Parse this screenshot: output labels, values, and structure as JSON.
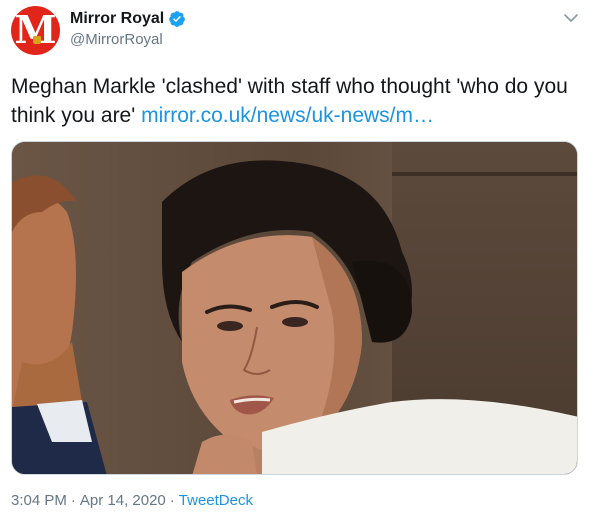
{
  "user": {
    "display_name": "Mirror Royal",
    "handle": "@MirrorRoyal",
    "avatar_letter": "M",
    "verified": true
  },
  "tweet": {
    "text": "Meghan Markle 'clashed' with staff who thought 'who do you think you are' ",
    "link_text": "mirror.co.uk/news/uk-news/m…"
  },
  "meta": {
    "time": "3:04 PM",
    "separator": "·",
    "date": "Apr 14, 2020",
    "source": "TweetDeck"
  },
  "colors": {
    "brand_red": "#e1251b",
    "link_blue": "#1b95e0",
    "verified_blue": "#1da1f2",
    "secondary_text": "#657786"
  }
}
